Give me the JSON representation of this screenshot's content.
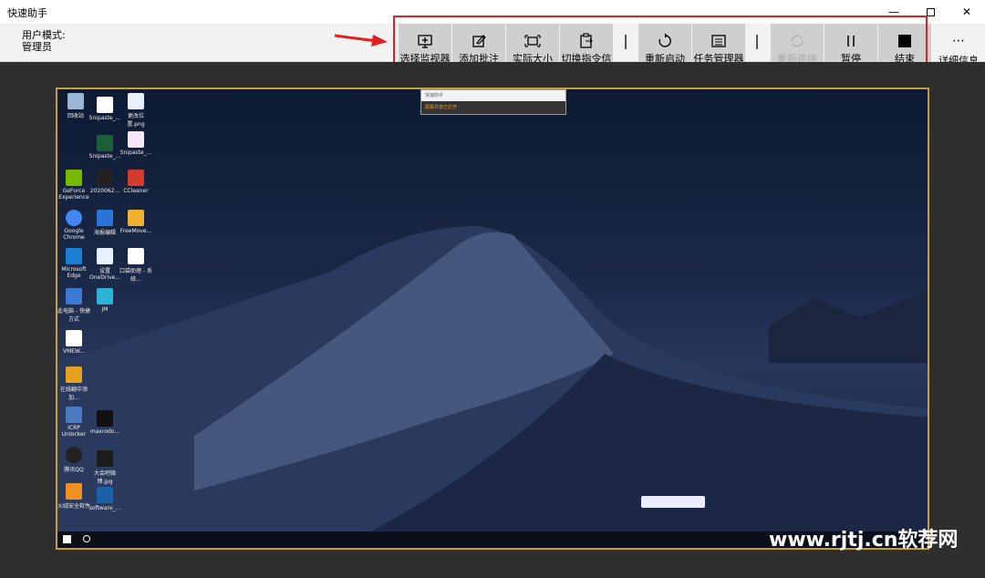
{
  "window": {
    "title": "快速助手",
    "min_icon": "minimize-icon",
    "max_icon": "maximize-icon",
    "close_icon": "close-icon"
  },
  "user": {
    "mode_label": "用户模式:",
    "mode_value": "管理员"
  },
  "toolbar": {
    "buttons": [
      {
        "label": "选择监视器",
        "icon": "monitor-icon"
      },
      {
        "label": "添加批注",
        "icon": "edit-icon"
      },
      {
        "label": "实际大小",
        "icon": "fit-size-icon"
      },
      {
        "label": "切换指令信道",
        "icon": "clipboard-switch-icon"
      },
      {
        "label": "重新启动",
        "icon": "restart-icon"
      },
      {
        "label": "任务管理器",
        "icon": "task-manager-icon"
      },
      {
        "label": "重新连接",
        "icon": "reconnect-icon",
        "disabled": true
      },
      {
        "label": "暂停",
        "icon": "pause-icon"
      },
      {
        "label": "结束",
        "icon": "stop-icon"
      }
    ],
    "more_label": "详细信息",
    "more_icon": "ellipsis-icon"
  },
  "remote": {
    "mini_window_title": "快速助手",
    "mini_window_status": "屏幕共享已打开",
    "desktop_icons": [
      "回收站",
      "Snipaste_...",
      "更改位置.png",
      "Snipaste_...",
      "Snipaste_...",
      "GeForce Experience",
      "2020062...",
      "CCleaner",
      "Google Chrome",
      "海报编辑",
      "FreeMove...",
      "Microsoft Edge",
      "设置 OneDrive...",
      "口袋助理 - 系统...",
      "此电脑 - 快捷方式",
      "JM",
      "VMEW...",
      "在线翻中添加...",
      "ICRP Unlocker",
      "maxrodo...",
      "腾讯QQ",
      "大会吧微博.jpg",
      "火绒安全软件",
      "software_..."
    ]
  },
  "watermark": "www.rjtj.cn软荐网",
  "colors": {
    "redbox": "#e02020",
    "toolbar_btn": "#cfcfcf",
    "remote_border": "#c8a032",
    "stage": "#2e2e2e"
  }
}
